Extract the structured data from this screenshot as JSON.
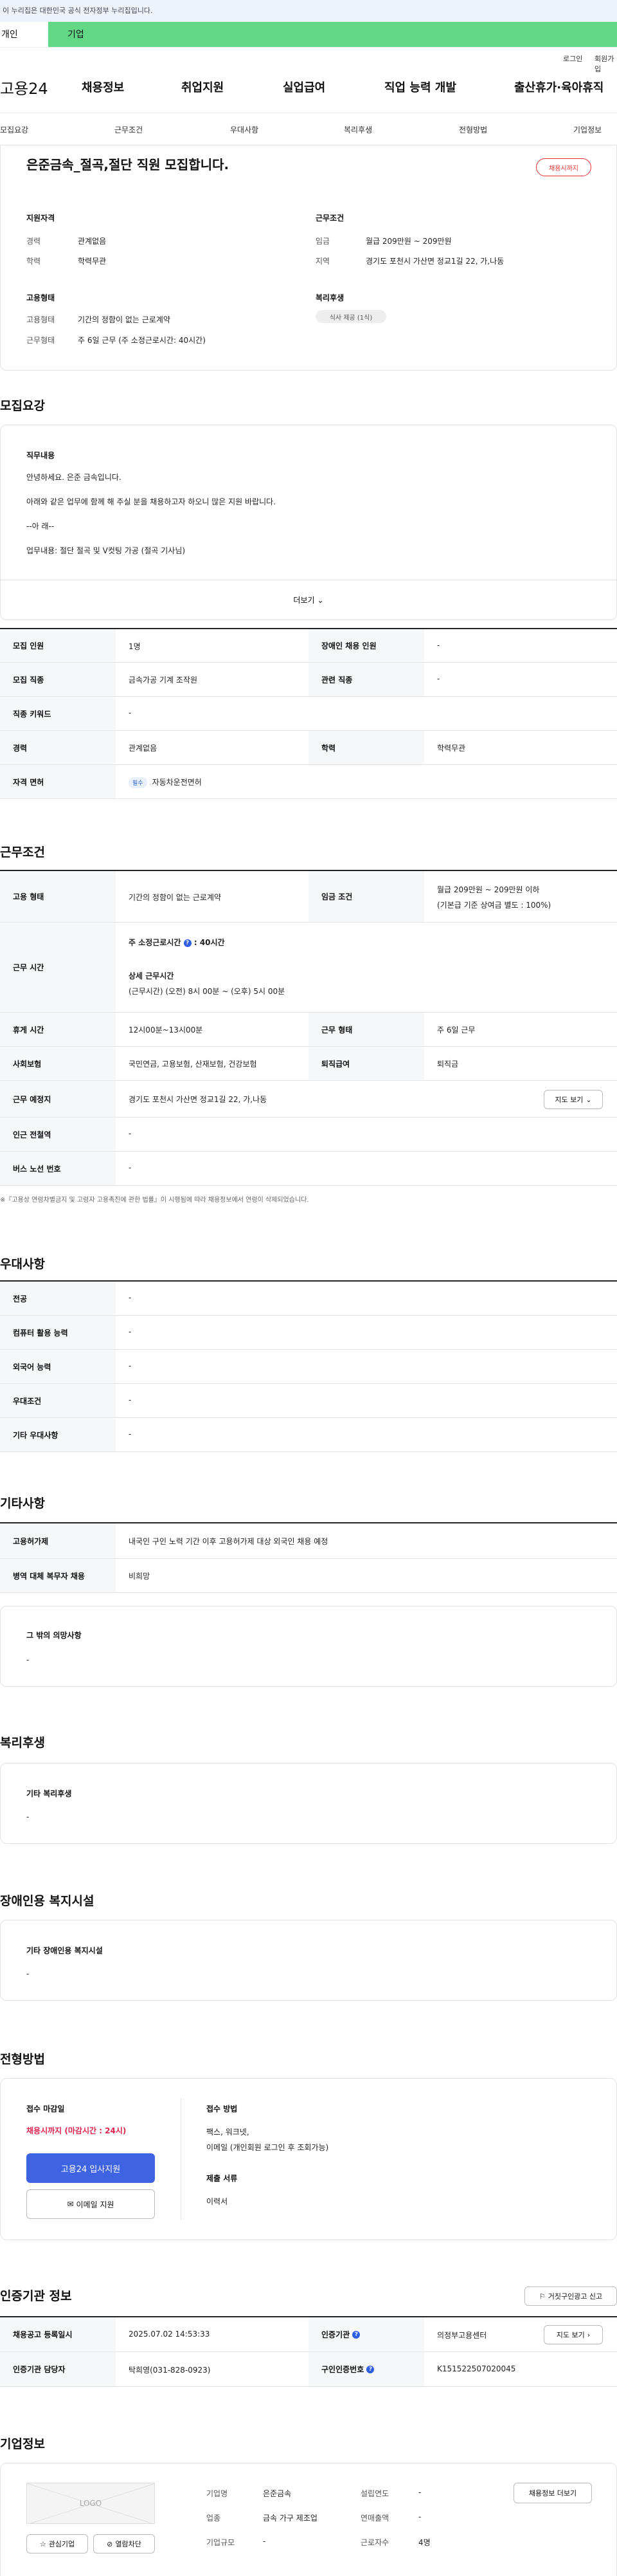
{
  "notice": "이 누리집은 대한민국 공식 전자정부 누리집입니다.",
  "tabs": [
    "개인",
    "기업"
  ],
  "util": {
    "login": "로그인",
    "join": "회원가입"
  },
  "gnb": {
    "logo": "고용24",
    "items": [
      "채용정보",
      "취업지원",
      "실업급여",
      "직업 능력 개발",
      "출산휴가·육아휴직"
    ]
  },
  "subnav": [
    "모집요강",
    "근무조건",
    "우대사항",
    "복리후생",
    "전형방법",
    "기업정보"
  ],
  "job": {
    "title": "은준금속_절곡,절단 직원 모집합니다.",
    "badge": "채용시까지",
    "qual_h": "지원자격",
    "career_l": "경력",
    "career_v": "관계없음",
    "edu_l": "학력",
    "edu_v": "학력무관",
    "cond_h": "근무조건",
    "wage_l": "임금",
    "wage_v": "월급 209만원 ~ 209만원",
    "area_l": "지역",
    "area_v": "경기도 포천시 가산면 정교1길 22, 가,나동",
    "emp_h": "고용형태",
    "etype_l": "고용형태",
    "etype_v": "기간의 정함이 없는 근로계약",
    "ework_l": "근무형태",
    "ework_v": "주 6일 근무 (주 소정근로시간: 40시간)",
    "ben_h": "복리후생",
    "ben_tag": "식사 제공 (1식)"
  },
  "recruit": {
    "h": "모집요강",
    "duty_h": "직무내용",
    "lines": [
      "안녕하세요. 은준 금속입니다.",
      "아래와 같은 업무에 함께 해 주실 분을 채용하고자 하오니 많은 지원 바랍니다.",
      "--아    래--",
      "업무내용: 절단 절곡 및 V컷팅 가공 (절곡 기사님)"
    ],
    "more": "더보기",
    "rows": [
      {
        "a": "모집 인원",
        "b": "1명",
        "c": "장애인 채용 인원",
        "d": "-"
      },
      {
        "a": "모집 직종",
        "b": "금속가공 기계 조작원",
        "c": "관련 직종",
        "d": "-"
      },
      {
        "a": "직종 키워드",
        "b": "-"
      },
      {
        "a": "경력",
        "b": "관계없음",
        "c": "학력",
        "d": "학력무관"
      },
      {
        "a": "자격 면허",
        "pill": "필수",
        "b": "자동차운전면허"
      }
    ]
  },
  "work": {
    "h": "근무조건",
    "etype_l": "고용 형태",
    "etype_v": "기간의 정함이 없는 근로계약",
    "wage_l": "임금 조건",
    "wage_v1": "월급 209만원 ~ 209만원 이하",
    "wage_v2": "(기본급 기준 상여금 별도 : 100%)",
    "hours_l": "근무 시간",
    "hours_a": "주 소정근로시간",
    "hours_b": ": 40시간",
    "hours_c": "상세 근무시간",
    "hours_d": "(근무시간) (오전) 8시 00분 ~ (오후) 5시 00분",
    "rest_l": "휴게 시간",
    "rest_v": "12시00분~13시00분",
    "form_l": "근무 형태",
    "form_v": "주 6일 근무",
    "ins_l": "사회보험",
    "ins_v": "국민연금, 고용보험, 산재보험, 건강보험",
    "ret_l": "퇴직급여",
    "ret_v": "퇴직금",
    "place_l": "근무 예정지",
    "place_v": "경기도 포천시 가산면 정교1길 22, 가,나동",
    "map": "지도 보기",
    "sub_l": "인근 전철역",
    "sub_v": "-",
    "bus_l": "버스 노선 번호",
    "bus_v": "-",
    "note": "※『고용상 연령차별금지 및 고령자 고용촉진에 관한 법률』이 시행됨에 따라 채용정보에서 연령이 삭제되었습니다."
  },
  "pref": {
    "h": "우대사항",
    "rows": [
      {
        "a": "전공",
        "b": "-"
      },
      {
        "a": "컴퓨터 활용 능력",
        "b": "-"
      },
      {
        "a": "외국어 능력",
        "b": "-"
      },
      {
        "a": "우대조건",
        "b": "-"
      },
      {
        "a": "기타 우대사항",
        "b": "-"
      }
    ]
  },
  "etc": {
    "h": "기타사항",
    "rows": [
      {
        "a": "고용허가제",
        "b": "내국인 구인 노력 기간 이후 고용허가제 대상 외국인 채용 예정"
      },
      {
        "a": "병역 대체 복무자 채용",
        "b": "비희망"
      }
    ],
    "other_h": "그 밖의 의망사항",
    "other_v": "-"
  },
  "welfare": {
    "h": "복리후생",
    "sub": "기타 복리후생",
    "v": "-"
  },
  "disab": {
    "h": "장애인용 복지시설",
    "sub": "기타 장애인용 복지시설",
    "v": "-"
  },
  "screen": {
    "h": "전형방법",
    "deadline_h": "접수 마감일",
    "deadline_v": "채용시까지 (마감시간 : 24시)",
    "apply": "고용24 입사지원",
    "email": "이메일 지원",
    "method_h": "접수 방법",
    "method_v1": "팩스, 워크넷,",
    "method_v2": "이메일 (개인회원 로그인 후 조회가능)",
    "docs_h": "제출 서류",
    "docs_v": "이력서"
  },
  "agency": {
    "h": "인증기관 정보",
    "report": "거짓구인광고 신고",
    "r1a": "채용공고 등록일시",
    "r1b": "2025.07.02 14:53:33",
    "r1c": "인증기관",
    "r1d": "의정부고용센터",
    "map": "지도 보기",
    "r2a": "인증기관 담당자",
    "r2b": "탁희영(031-828-0923)",
    "r2c": "구인인증번호",
    "r2d": "K151522507020045"
  },
  "company": {
    "h": "기업정보",
    "logo": "LOGO",
    "fav": "관심기업",
    "block": "열람차단",
    "name_l": "기업명",
    "name_v": "은준금속",
    "est_l": "설립연도",
    "est_v": "-",
    "ind_l": "업종",
    "ind_v": "금속 가구 제조업",
    "sales_l": "연매출액",
    "sales_v": "-",
    "size_l": "기업규모",
    "size_v": "-",
    "staff_l": "근로자수",
    "staff_v": "4명",
    "more": "채용정보 더보기"
  }
}
